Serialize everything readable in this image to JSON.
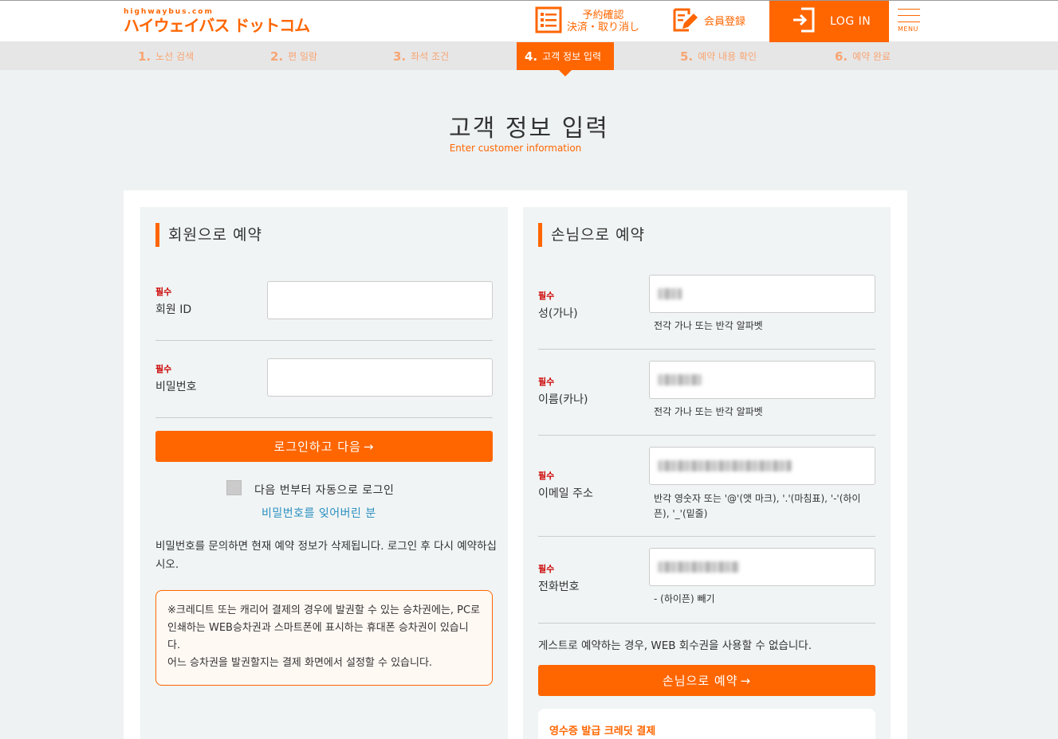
{
  "header": {
    "logo_small": "highwaybus.com",
    "logo_big": "ハイウェイバス ドットコム",
    "confirm_line1": "予約確認",
    "confirm_line2": "決済・取り消し",
    "register_label": "会員登録",
    "login_label": "LOG IN",
    "menu_label": "MENU"
  },
  "steps": [
    {
      "num": "1.",
      "label": "노선 검색"
    },
    {
      "num": "2.",
      "label": "편 일람"
    },
    {
      "num": "3.",
      "label": "좌석 조건"
    },
    {
      "num": "4.",
      "label": "고객 정보 입력"
    },
    {
      "num": "5.",
      "label": "예약 내용 확인"
    },
    {
      "num": "6.",
      "label": "예약 완료"
    }
  ],
  "page": {
    "title": "고객 정보 입력",
    "subtitle": "Enter customer information"
  },
  "member": {
    "heading": "회원으로 예약",
    "required": "필수",
    "id_label": "회원 ID",
    "pw_label": "비밀번호",
    "login_button": "로그인하고 다음",
    "auto_login": "다음 번부터 자동으로 로그인",
    "forgot_pw": "비밀번호를 잊어버린 분",
    "pw_note": "비밀번호를 문의하면 현재 예약 정보가 삭제됩니다. 로그인 후 다시 예약하십시오.",
    "notice": "※크레디트 또는 캐리어 결제의 경우에 발권할 수 있는 승차권에는, PC로 인쇄하는 WEB승차권과 스마트폰에 표시하는 휴대폰 승차권이 있습니다.\n어느 승차권을 발권할지는 결제 화면에서 설정할 수 있습니다."
  },
  "guest": {
    "heading": "손님으로 예약",
    "required": "필수",
    "surname_label": "성(가나)",
    "surname_hint": "전각 가나 또는 반각 알파벳",
    "name_label": "이름(카나)",
    "name_hint": "전각 가나 또는 반각 알파벳",
    "email_label": "이메일 주소",
    "email_hint": "반각 영숫자 또는 '@'(앳 마크), '.'(마침표), '-'(하이픈), '_'(밑줄)",
    "phone_label": "전화번호",
    "phone_hint": "- (하이픈) 빼기",
    "guest_note": "게스트로 예약하는 경우, WEB 회수권을 사용할 수 없습니다.",
    "guest_button": "손님으로 예약",
    "receipt_title": "영수증 발급 크레딧 결제"
  },
  "colors": {
    "accent": "#ff6600",
    "required": "#cc0000",
    "link": "#2a8fc0"
  }
}
